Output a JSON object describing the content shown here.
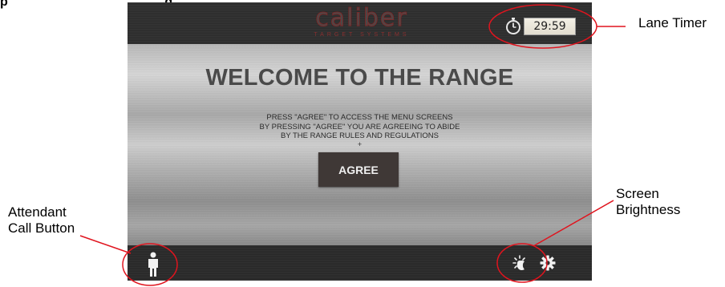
{
  "heading_fragment": "p                                            g",
  "device": {
    "logo": {
      "word": "caliber",
      "subtitle": "TARGET SYSTEMS"
    },
    "timer": {
      "value": "29:59",
      "icon": "stopwatch-icon"
    },
    "welcome_title": "WELCOME TO THE RANGE",
    "instructions": [
      "PRESS \"AGREE\" TO ACCESS THE MENU SCREENS",
      "BY PRESSING \"AGREE\" YOU ARE AGREEING TO ABIDE",
      "BY THE RANGE RULES AND REGULATIONS"
    ],
    "plus": "+",
    "agree_label": "AGREE",
    "bottom_icons": [
      "person-icon",
      "brightness-icon",
      "gear-icon"
    ]
  },
  "callouts": {
    "lane_timer": "Lane Timer",
    "screen_brightness": [
      "Screen",
      "Brightness"
    ],
    "attendant_call": [
      "Attendant",
      "Call Button"
    ]
  },
  "colors": {
    "agree_button": "#3f3836",
    "callout_line": "#e0141e",
    "logo_accent": "#8a3030"
  }
}
